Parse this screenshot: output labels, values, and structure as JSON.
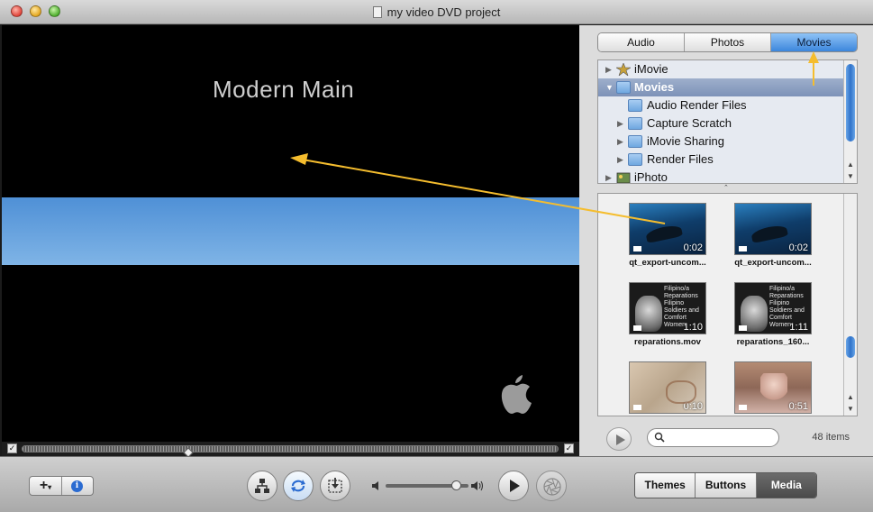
{
  "window": {
    "title": "my video DVD project"
  },
  "preview": {
    "theme_title": "Modern Main"
  },
  "media_tabs": [
    {
      "label": "Audio",
      "active": false
    },
    {
      "label": "Photos",
      "active": false
    },
    {
      "label": "Movies",
      "active": true
    }
  ],
  "source_tree": [
    {
      "label": "iMovie",
      "icon": "star-icon",
      "indent": 0,
      "expanded": false,
      "selected": false
    },
    {
      "label": "Movies",
      "icon": "movies-folder-icon",
      "indent": 0,
      "expanded": true,
      "selected": true
    },
    {
      "label": "Audio Render Files",
      "icon": "folder-icon",
      "indent": 1,
      "expanded": null,
      "selected": false
    },
    {
      "label": "Capture Scratch",
      "icon": "folder-icon",
      "indent": 1,
      "expanded": false,
      "selected": false
    },
    {
      "label": "iMovie Sharing",
      "icon": "folder-icon",
      "indent": 1,
      "expanded": false,
      "selected": false
    },
    {
      "label": "Render Files",
      "icon": "folder-icon",
      "indent": 1,
      "expanded": false,
      "selected": false
    },
    {
      "label": "iPhoto",
      "icon": "iphoto-icon",
      "indent": 0,
      "expanded": false,
      "selected": false
    }
  ],
  "movies": [
    {
      "name": "qt_export-uncom...",
      "duration": "0:02",
      "thumb": "ocean"
    },
    {
      "name": "qt_export-uncom...",
      "duration": "0:02",
      "thumb": "ocean"
    },
    {
      "name": "reparations.mov",
      "duration": "1:10",
      "thumb": "reparations"
    },
    {
      "name": "reparations_160...",
      "duration": "1:11",
      "thumb": "reparations"
    },
    {
      "name": "",
      "duration": "0:10",
      "thumb": "map"
    },
    {
      "name": "",
      "duration": "0:51",
      "thumb": "girl"
    }
  ],
  "reparations_thumb_text": {
    "line1": "Filipino/a Reparations",
    "line2": "Filipino Soldiers and Comfort Women"
  },
  "media_footer": {
    "items_count": "48 items"
  },
  "bottom_tabs": [
    {
      "label": "Themes",
      "active": false
    },
    {
      "label": "Buttons",
      "active": false
    },
    {
      "label": "Media",
      "active": true
    }
  ],
  "colors": {
    "selection_blue": "#3c86dc",
    "annotation_arrow": "#f5bd2e"
  },
  "volume_level": 0.85
}
